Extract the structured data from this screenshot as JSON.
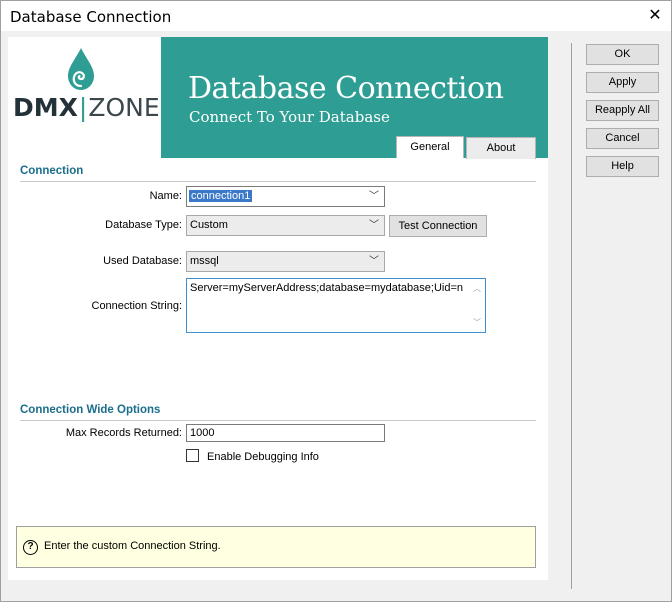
{
  "window": {
    "title": "Database Connection",
    "close_glyph": "✕"
  },
  "header": {
    "title": "Database Connection",
    "subtitle": "Connect To Your Database",
    "logo": {
      "left": "DMX",
      "separator": "|",
      "right": "ZONE"
    }
  },
  "tabs": [
    {
      "label": "General",
      "active": true
    },
    {
      "label": "About",
      "active": false
    }
  ],
  "connection": {
    "section_title": "Connection",
    "name_label": "Name:",
    "name_value": "connection1",
    "db_type_label": "Database Type:",
    "db_type_value": "Custom",
    "test_button": "Test Connection",
    "used_db_label": "Used Database:",
    "used_db_value": "mssql",
    "conn_string_label": "Connection String:",
    "conn_string_value": "Server=myServerAddress;database=mydatabase;Uid=n"
  },
  "wide_options": {
    "section_title": "Connection Wide Options",
    "max_records_label": "Max Records Returned:",
    "max_records_value": "1000",
    "debug_label": "Enable Debugging Info",
    "debug_checked": false
  },
  "hint": {
    "icon": "question-icon",
    "text": "Enter the custom Connection String."
  },
  "side_buttons": {
    "ok": "OK",
    "apply": "Apply",
    "reapply_all": "Reapply All",
    "cancel": "Cancel",
    "help": "Help"
  },
  "colors": {
    "teal": "#2e9e94",
    "section_title": "#1b6e8c",
    "hint_bg": "#ffffe1",
    "selection": "#3a78c8"
  }
}
